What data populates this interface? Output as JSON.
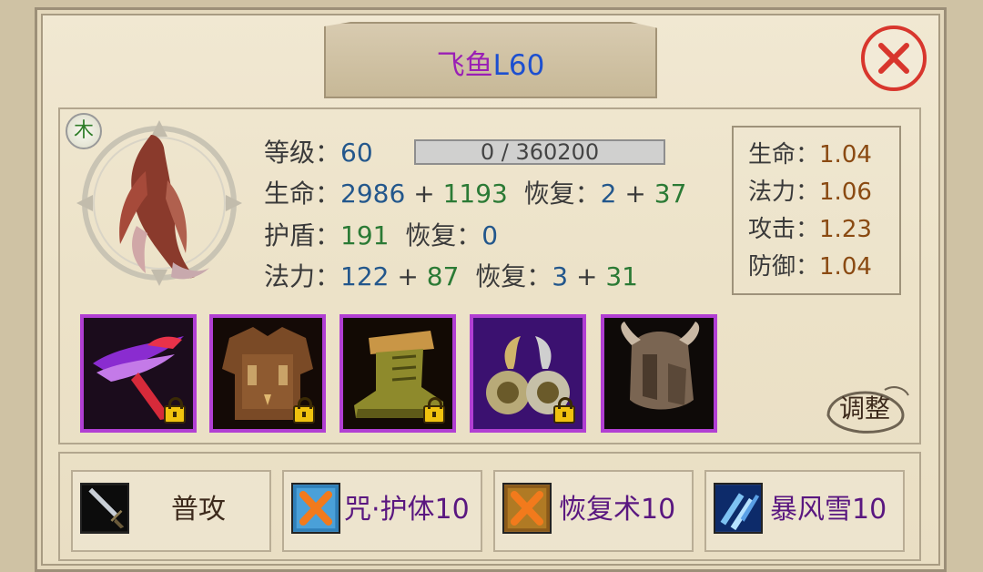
{
  "title": {
    "name": "飞鱼",
    "level": "L60"
  },
  "element": "木",
  "stats": {
    "level_label": "等级：",
    "level_value": "60",
    "exp_text": "0 / 360200",
    "hp_label": "生命：",
    "hp_base": "2986",
    "hp_bonus": "1193",
    "hp_regen_label": "恢复：",
    "hp_regen_base": "2",
    "hp_regen_bonus": "37",
    "shield_label": "护盾：",
    "shield_value": "191",
    "shield_regen_label": "恢复：",
    "shield_regen_value": "0",
    "mp_label": "法力：",
    "mp_base": "122",
    "mp_bonus": "87",
    "mp_regen_label": "恢复：",
    "mp_regen_base": "3",
    "mp_regen_bonus": "31",
    "plus": "+"
  },
  "growth": [
    {
      "label": "生命：",
      "value": "1.04"
    },
    {
      "label": "法力：",
      "value": "1.06"
    },
    {
      "label": "攻击：",
      "value": "1.23"
    },
    {
      "label": "防御：",
      "value": "1.04"
    }
  ],
  "equipment": [
    {
      "icon": "weapon-blade-icon",
      "locked": true
    },
    {
      "icon": "armor-chest-icon",
      "locked": true
    },
    {
      "icon": "boots-icon",
      "locked": true
    },
    {
      "icon": "ornament-icon",
      "locked": true
    },
    {
      "icon": "helmet-icon",
      "locked": false
    }
  ],
  "adjust_label": "调整",
  "skills": [
    {
      "label": "普攻",
      "icon": "sword-icon"
    },
    {
      "label": "咒·护体10",
      "icon": "disabled-skill-icon"
    },
    {
      "label": "恢复术10",
      "icon": "disabled-skill-icon"
    },
    {
      "label": "暴风雪10",
      "icon": "blizzard-icon"
    }
  ],
  "colors": {
    "title_name": "#9a1fb5",
    "title_level": "#1c4fd0",
    "equip_border": "#b13fd3",
    "close": "#d8362d",
    "skill_text": "#5a1780"
  }
}
